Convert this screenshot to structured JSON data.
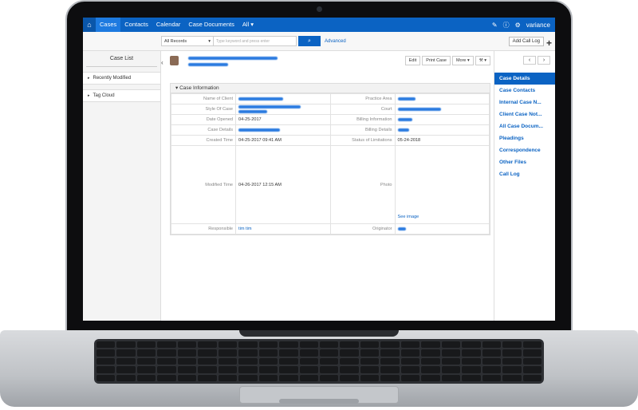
{
  "nav": {
    "home_icon": "home-icon",
    "tabs": [
      "Cases",
      "Contacts",
      "Calendar",
      "Case Documents",
      "All ▾"
    ],
    "user": "variance"
  },
  "toolbar": {
    "scope": "All Records",
    "search_placeholder": "Type keyword and press enter",
    "advanced": "Advanced",
    "add_call_log": "Add Call Log"
  },
  "sidebar": {
    "title": "Case List",
    "items": [
      "Recently Modified",
      "Tag Cloud"
    ]
  },
  "actions": [
    "Edit",
    "Print Case",
    "More ▾",
    "▾"
  ],
  "section": "Case Information",
  "fields": {
    "name_of_client": "Name of Client",
    "practice_area": "Practice Area",
    "style_of_case": "Style Of Case",
    "court": "Court",
    "date_opened": "Date Opened",
    "date_opened_val": "04-25-2017",
    "billing_information": "Billing Information",
    "case_details": "Case Details",
    "billing_details": "Billing Details",
    "created_time": "Created Time",
    "created_time_val": "04-25-2017 09:41 AM",
    "status_of_limitations": "Status of Limitations",
    "status_val": "05-24-2018",
    "modified_time": "Modified Time",
    "modified_time_val": "04-26-2017 12:15 AM",
    "photo": "Photo",
    "see_image": "See image",
    "responsible": "Responsible",
    "responsible_val": "tim tim",
    "originator": "Originator"
  },
  "right_nav": {
    "items": [
      "Case Details",
      "Case Contacts",
      "Internal Case N...",
      "Client Case Not...",
      "All Case Docum...",
      "Pleadings",
      "Correspondence",
      "Other Files",
      "Call Log"
    ],
    "active": "Case Details"
  }
}
